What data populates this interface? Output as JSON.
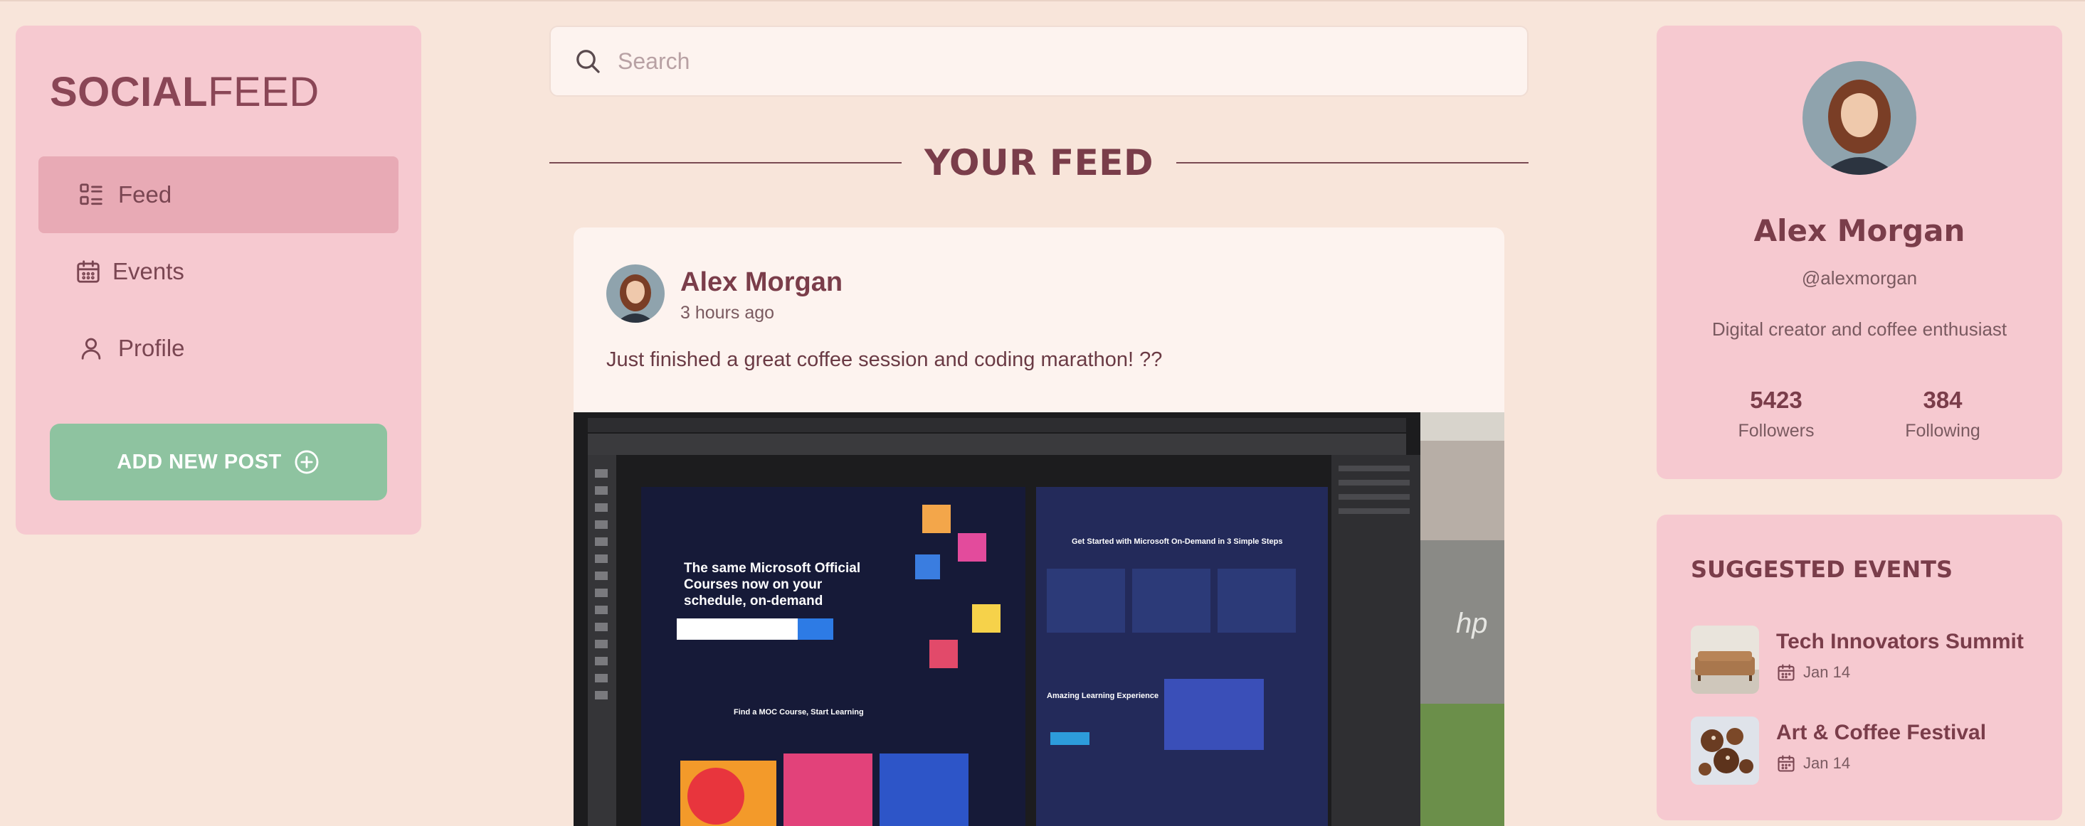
{
  "app": {
    "logo_bold": "SOCIAL",
    "logo_light": "FEED"
  },
  "sidebar": {
    "items": [
      {
        "label": "Feed",
        "icon": "feed-icon",
        "active": true
      },
      {
        "label": "Events",
        "icon": "calendar-icon",
        "active": false
      },
      {
        "label": "Profile",
        "icon": "user-icon",
        "active": false
      }
    ],
    "add_post_label": "ADD NEW POST"
  },
  "search": {
    "placeholder": "Search"
  },
  "feed": {
    "heading": "YOUR FEED",
    "posts": [
      {
        "author": "Alex Morgan",
        "time": "3 hours ago",
        "text": "Just finished a great coffee session and coding marathon! ??"
      }
    ]
  },
  "profile": {
    "name": "Alex Morgan",
    "handle": "@alexmorgan",
    "bio": "Digital creator and coffee enthusiast",
    "followers_count": "5423",
    "followers_label": "Followers",
    "following_count": "384",
    "following_label": "Following"
  },
  "events": {
    "heading": "SUGGESTED EVENTS",
    "items": [
      {
        "title": "Tech Innovators Summit",
        "date": "Jan 14"
      },
      {
        "title": "Art & Coffee Festival",
        "date": "Jan 14"
      }
    ]
  },
  "colors": {
    "background": "#f8e5da",
    "panel": "#f6c9d0",
    "active_nav": "#e8aab5",
    "accent_green": "#8ec3a0",
    "text": "#7a3d4a",
    "card": "#fdf3ef"
  }
}
